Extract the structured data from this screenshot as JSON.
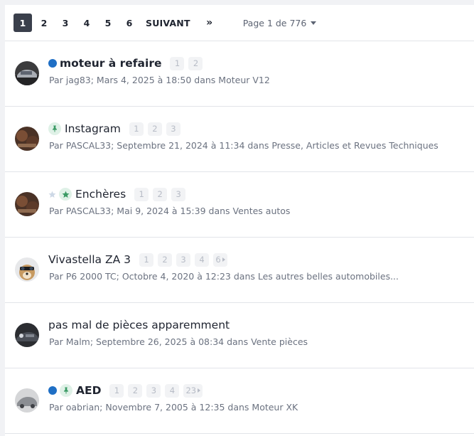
{
  "pagination": {
    "pages": [
      "1",
      "2",
      "3",
      "4",
      "5",
      "6"
    ],
    "active": "1",
    "next_label": "SUIVANT",
    "last_label": "»",
    "page_info": "Page 1 de 776"
  },
  "threads": [
    {
      "title": "moteur à refaire",
      "bold": true,
      "unread": true,
      "sticky": false,
      "featured": false,
      "pages": [
        "1",
        "2"
      ],
      "meta": "Par jag83; Mars 4, 2025 à 18:50 dans Moteur V12",
      "avatar": "car-silver"
    },
    {
      "title": "Instagram",
      "bold": false,
      "unread": false,
      "sticky": true,
      "featured": false,
      "pages": [
        "1",
        "2",
        "3"
      ],
      "meta": "Par PASCAL33; Septembre 21, 2024 à 11:34 dans Presse, Articles et Revues Techniques",
      "avatar": "car-brown"
    },
    {
      "title": "Enchères",
      "bold": false,
      "unread": false,
      "sticky": false,
      "featured": true,
      "pages": [
        "1",
        "2",
        "3"
      ],
      "meta": "Par PASCAL33; Mai 9, 2024 à 15:39 dans Ventes autos",
      "avatar": "car-brown"
    },
    {
      "title": "Vivastella ZA 3",
      "bold": false,
      "unread": false,
      "sticky": false,
      "featured": false,
      "pages": [
        "1",
        "2",
        "3",
        "4",
        "6"
      ],
      "meta": "Par P6 2000 TC; Octobre 4, 2020 à 12:23 dans Les autres belles automobiles...",
      "avatar": "dog"
    },
    {
      "title": "pas mal de pièces apparemment",
      "bold": false,
      "unread": false,
      "sticky": false,
      "featured": false,
      "pages": [],
      "meta": "Par Malm; Septembre 26, 2025 à 08:34 dans Vente pièces",
      "avatar": "car-dark"
    },
    {
      "title": "AED",
      "bold": true,
      "unread": true,
      "sticky": true,
      "featured": false,
      "pages": [
        "1",
        "2",
        "3",
        "4",
        "23"
      ],
      "meta": "Par oabrian; Novembre 7, 2005 à 12:35 dans Moteur XK",
      "avatar": "car-grey"
    }
  ],
  "colors": {
    "unread": "#1f6fc5",
    "pin": "#3a9a64",
    "active_page": "#3a3f4b"
  }
}
